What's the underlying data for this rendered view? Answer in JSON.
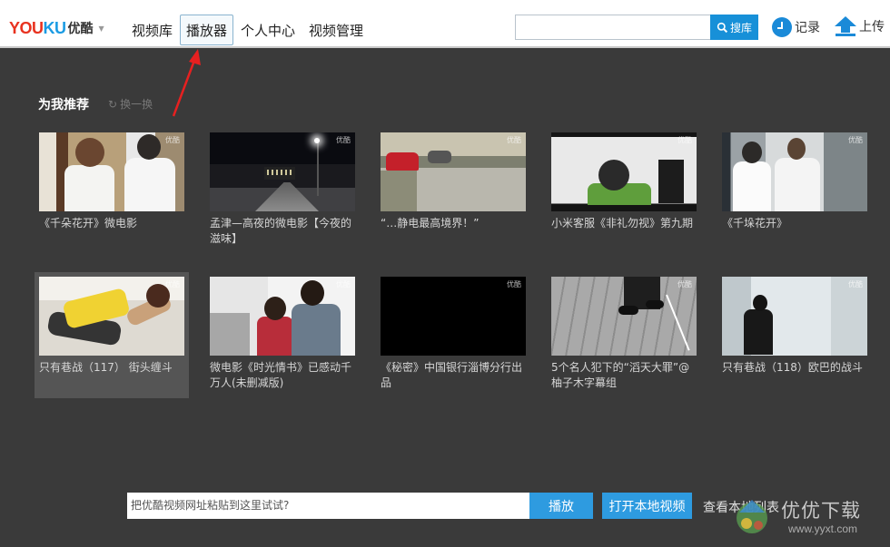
{
  "header": {
    "logo_text_a": "YOU",
    "logo_text_b": "KU",
    "logo_cn": "优酷",
    "nav": [
      {
        "label": "视频库"
      },
      {
        "label": "播放器"
      },
      {
        "label": "个人中心"
      },
      {
        "label": "视频管理"
      }
    ],
    "active_nav": "播放器",
    "search_value": "",
    "search_button": "搜库",
    "record_label": "记录",
    "upload_label": "上传"
  },
  "recommend": {
    "title": "为我推荐",
    "refresh_label": "换一换",
    "videos": [
      {
        "title": "《千朵花开》微电影",
        "watermark": "优酷"
      },
      {
        "title": "孟津—高夜的微电影【今夜的滋味】",
        "watermark": "优酷"
      },
      {
        "title": "“…静电最高境界！”",
        "watermark": "优酷"
      },
      {
        "title": "小米客服《非礼勿视》第九期",
        "watermark": "优酷"
      },
      {
        "title": "《千垛花开》",
        "watermark": "优酷"
      },
      {
        "title": "只有巷战（117） 街头缠斗",
        "watermark": "优酷"
      },
      {
        "title": "微电影《时光情书》已感动千万人(未删减版)",
        "watermark": "优酷"
      },
      {
        "title": "《秘密》中国银行淄博分行出品",
        "watermark": "优酷"
      },
      {
        "title": "5个名人犯下的“滔天大罪”@柚子木字幕组",
        "watermark": "优酷"
      },
      {
        "title": "只有巷战（118）欧巴的战斗",
        "watermark": "优酷"
      }
    ]
  },
  "player_bar": {
    "url_placeholder": "把优酷视频网址粘贴到这里试试?",
    "play_label": "播放",
    "open_local_label": "打开本地视频",
    "local_list_label": "查看本地列表"
  },
  "site_watermark": {
    "title": "优优下载",
    "url": "www.yyxt.com"
  },
  "colors": {
    "background": "#3a3a3a",
    "accent": "#2e9be0",
    "logo_red": "#e8321f",
    "logo_blue": "#1a9be3",
    "callout_red": "#e62020"
  }
}
